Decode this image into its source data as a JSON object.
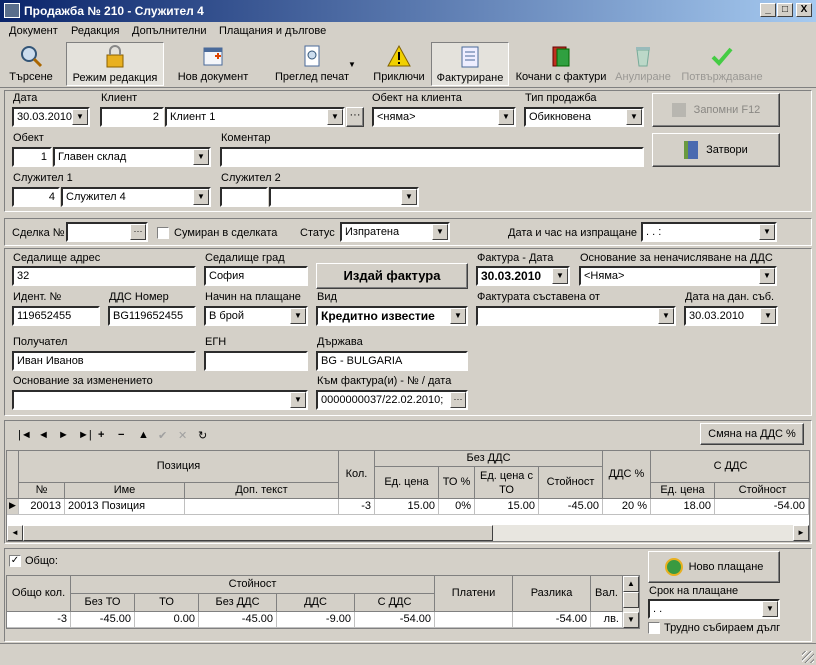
{
  "window": {
    "title": "Продажба № 210 - Служител 4",
    "min": "_",
    "max": "□",
    "close": "X"
  },
  "menu": [
    "Документ",
    "Редакция",
    "Допълнителни",
    "Плащания и дългове"
  ],
  "toolbar": [
    {
      "label": "Търсене",
      "icon": "magnifier-icon"
    },
    {
      "label": "Режим редакция",
      "icon": "lock-icon"
    },
    {
      "label": "Нов документ",
      "icon": "new-document-icon"
    },
    {
      "label": "Преглед печат",
      "icon": "print-preview-icon"
    },
    {
      "label": "Приключи",
      "icon": "warning-icon"
    },
    {
      "label": "Фактуриране",
      "icon": "invoice-icon"
    },
    {
      "label": "Кочани с фактури",
      "icon": "invoice-books-icon"
    },
    {
      "label": "Анулиране",
      "icon": "recycle-bin-icon"
    },
    {
      "label": "Потвърждаване",
      "icon": "checkmark-icon"
    }
  ],
  "header": {
    "date_label": "Дата",
    "date": "30.03.2010",
    "client_label": "Клиент",
    "client_id": "2",
    "client_name": "Клиент 1",
    "client_object_label": "Обект на клиента",
    "client_object": "<няма>",
    "sale_type_label": "Тип продажба",
    "sale_type": "Обикновена",
    "save_button": "Запомни  F12",
    "object_label": "Обект",
    "object_id": "1",
    "object_name": "Главен склад",
    "comment_label": "Коментар",
    "comment": "",
    "close_button": "Затвори",
    "employee1_label": "Служител 1",
    "employee1_id": "4",
    "employee1_name": "Служител 4",
    "employee2_label": "Служител 2",
    "employee2_id": "",
    "employee2_name": ""
  },
  "deal": {
    "deal_no_label": "Сделка №",
    "deal_no": "",
    "summed_label": "Сумиран в сделката",
    "status_label": "Статус",
    "status": "Изпратена",
    "send_dt_label": "Дата и час на изпращане",
    "send_dt": " .  .      :"
  },
  "invoice": {
    "address_label": "Седалище адрес",
    "address": "32",
    "city_label": "Седалище град",
    "city": "София",
    "issue_button": "Издай фактура",
    "inv_date_label": "Фактура - Дата",
    "inv_date": "30.03.2010",
    "no_vat_reason_label": "Основание за неначисляване на ДДС",
    "no_vat_reason": "<Няма>",
    "ident_label": "Идент. №",
    "ident": "119652455",
    "vat_no_label": "ДДС Номер",
    "vat_no": "BG119652455",
    "payment_method_label": "Начин на плащане",
    "payment_method": "В брой",
    "type_label": "Вид",
    "type": "Кредитно известие",
    "composed_by_label": "Фактурата съставена от",
    "composed_by": "",
    "tax_event_date_label": "Дата на дан. съб.",
    "tax_event_date": "30.03.2010",
    "recipient_label": "Получател",
    "recipient": "Иван Иванов",
    "egn_label": "ЕГН",
    "egn": "",
    "country_label": "Държава",
    "country": "BG - BULGARIA",
    "change_reason_label": "Основание за изменението",
    "change_reason": "",
    "to_invoice_label": "Към фактура(и) - № / дата",
    "to_invoice": "0000000037/22.02.2010;"
  },
  "items": {
    "vat_change_button": "Смяна на ДДС %",
    "nav": [
      "|◄",
      "◄",
      "►",
      "►|",
      "+",
      "−",
      "▲",
      "✔",
      "✕",
      "↻"
    ],
    "h_position": "Позиция",
    "h_qty": "Кол.",
    "h_novat": "Без ДДС",
    "h_vatpct": "ДДС %",
    "h_withvat": "С ДДС",
    "h_no": "№",
    "h_name": "Име",
    "h_extra": "Доп. текст",
    "h_unit": "Ед. цена",
    "h_to": "ТО %",
    "h_unit_to": "Ед. цена с ТО",
    "h_value": "Стойност",
    "h_unit2": "Ед. цена",
    "h_value2": "Стойност",
    "rows": [
      {
        "no": "20013",
        "name": "20013 Позиция",
        "extra": "",
        "qty": "-3",
        "unit": "15.00",
        "to": "0%",
        "unit_to": "15.00",
        "value": "-45.00",
        "vat": "20 %",
        "unit_vat": "18.00",
        "value_vat": "-54.00"
      }
    ]
  },
  "totals": {
    "total_label": "Общо:",
    "new_payment_button": "Ново плащане",
    "due_label": "Срок на плащане",
    "due": " .  .",
    "bad_debt_label": "Трудно събираем дълг",
    "h_qty": "Общо кол.",
    "h_value": "Стойност",
    "h_paid": "Платени",
    "h_diff": "Разлика",
    "h_cur": "Вал.",
    "h_no_to": "Без ТО",
    "h_to": "ТО",
    "h_no_vat": "Без ДДС",
    "h_vat": "ДДС",
    "h_with_vat": "С ДДС",
    "qty": "-3",
    "no_to": "-45.00",
    "to": "0.00",
    "no_vat": "-45.00",
    "vat": "-9.00",
    "with_vat": "-54.00",
    "paid": "",
    "diff": "-54.00",
    "cur": "лв."
  }
}
